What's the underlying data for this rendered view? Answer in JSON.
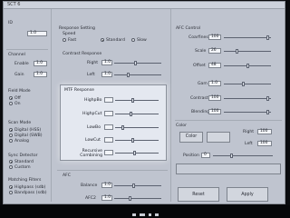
{
  "window": {
    "title": "SCT 6"
  },
  "left": {
    "top_label": "ID",
    "top_value": "1.0",
    "channel": {
      "heading": "Channel",
      "items": [
        {
          "label": "Enable",
          "value": "1.0"
        },
        {
          "label": "Gain",
          "value": "1.0"
        }
      ]
    },
    "field_mode": {
      "heading": "Field Mode",
      "options": [
        "Off",
        "On"
      ],
      "selected": 0
    },
    "scan_mode": {
      "heading": "Scan Mode",
      "options": [
        "Digital (HSS)",
        "Digital (SWB)",
        "Analog"
      ],
      "selected": 0
    },
    "sync_detector": {
      "heading": "Sync Detector",
      "options": [
        "Standard",
        "Custom"
      ],
      "selected": 0
    },
    "matching_filters": {
      "heading": "Matching Filters",
      "options": [
        "Highpass (sdb)",
        "Bandpass (sdb)"
      ],
      "selected": 0
    }
  },
  "middle": {
    "response_setting": {
      "heading": "Response Setting",
      "sub": "Speed",
      "options": [
        "Fast",
        "Standard",
        "Slow"
      ],
      "selected": 1
    },
    "contrast_response": {
      "heading": "Contrast Response",
      "rows": [
        {
          "label": "Right",
          "value": "1.0"
        },
        {
          "label": "Left",
          "value": "1.0"
        }
      ]
    },
    "afc": {
      "heading": "AFC",
      "rows": [
        {
          "label": "Balance",
          "value": "1.0"
        },
        {
          "label": "AFC2",
          "value": "1.0"
        }
      ]
    }
  },
  "mtf_panel": {
    "title": "MTF Response",
    "rows": [
      {
        "label": "HighpBo",
        "value": "",
        "level": 0.4
      },
      {
        "label": "HighpCut",
        "value": "",
        "level": 0.35
      },
      {
        "label": "LowBo",
        "value": "",
        "level": 0.15
      },
      {
        "label": "LowCut",
        "value": "",
        "level": 0.4
      },
      {
        "label": "Recursive Combining",
        "value": "",
        "level": 0.45
      }
    ]
  },
  "right": {
    "heading": "AFC Control",
    "rows": [
      {
        "label": "Coarfines",
        "value": "100"
      },
      {
        "label": "Scale",
        "value": "26"
      },
      {
        "label": "Offset",
        "value": "48"
      }
    ],
    "rows2": [
      {
        "label": "Gam",
        "value": "1.0"
      },
      {
        "label": "Contrast",
        "value": "100"
      },
      {
        "label": "Blending",
        "value": "100"
      }
    ],
    "color": {
      "heading": "Color",
      "button_a": "Color",
      "button_b": "",
      "right_label": "Right",
      "right_value": "100",
      "left_label": "Left",
      "left_value": "100"
    },
    "position": {
      "label": "Position",
      "value": "0"
    }
  },
  "buttons": {
    "reset": "Reset",
    "apply": "Apply"
  }
}
